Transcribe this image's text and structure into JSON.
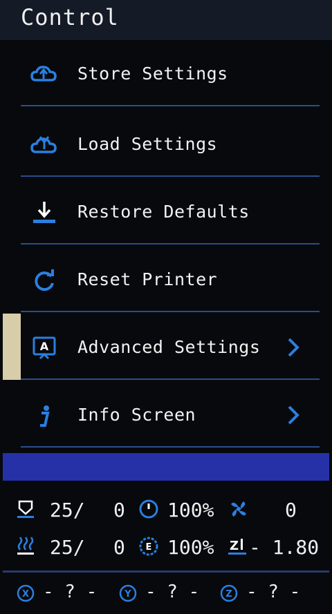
{
  "header": {
    "title": "Control"
  },
  "menu": {
    "items": [
      {
        "label": "Store Settings",
        "icon": "cloud-upload-icon"
      },
      {
        "label": "Load Settings",
        "icon": "cloud-download-icon"
      },
      {
        "label": "Restore Defaults",
        "icon": "restore-download-icon"
      },
      {
        "label": "Reset Printer",
        "icon": "refresh-icon"
      },
      {
        "label": "Advanced Settings",
        "icon": "advanced-a-icon",
        "selected": true,
        "has_submenu": true
      },
      {
        "label": "Info Screen",
        "icon": "info-icon",
        "has_submenu": true
      }
    ]
  },
  "status": {
    "hotend_current": "25/",
    "hotend_target": "0",
    "speed": "100%",
    "fan": "0",
    "bed_current": "25/",
    "bed_target": "0",
    "flow": "100%",
    "z_offset": "- 1.80"
  },
  "axes": {
    "x": "- ? -",
    "y": "- ? -",
    "z": "- ? -"
  },
  "colors": {
    "accent_blue": "#2a80e0",
    "selected_bar": "#d8cda9",
    "status_band": "#2631a8"
  }
}
